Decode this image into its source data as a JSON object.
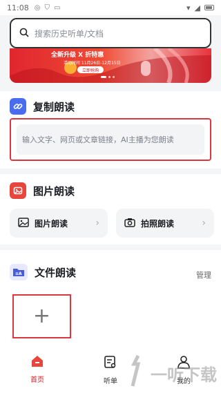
{
  "status_bar": {
    "time": "11:08"
  },
  "search": {
    "placeholder": "搜索历史听单/文档"
  },
  "banner": {
    "headline": "全新升级 X 折特惠",
    "subtitle": "活动时间 11月26日-12月15日",
    "cta": "立即抢购"
  },
  "copy_read": {
    "title": "复制朗读",
    "input_placeholder": "输入文字、网页或文章链接，AI主播为您朗读"
  },
  "image_read": {
    "title": "图片朗读",
    "options": [
      {
        "label": "图片朗读"
      },
      {
        "label": "拍照朗读"
      }
    ]
  },
  "file_read": {
    "title": "文件朗读",
    "manage_label": "管理",
    "add_label": "+"
  },
  "bottom_nav": [
    {
      "label": "首页",
      "active": true
    },
    {
      "label": "听单",
      "active": false
    },
    {
      "label": "我的",
      "active": false
    }
  ],
  "watermark": {
    "text": "一听下载"
  },
  "colors": {
    "accent": "#d2202a",
    "highlight_border": "#d9363e"
  }
}
